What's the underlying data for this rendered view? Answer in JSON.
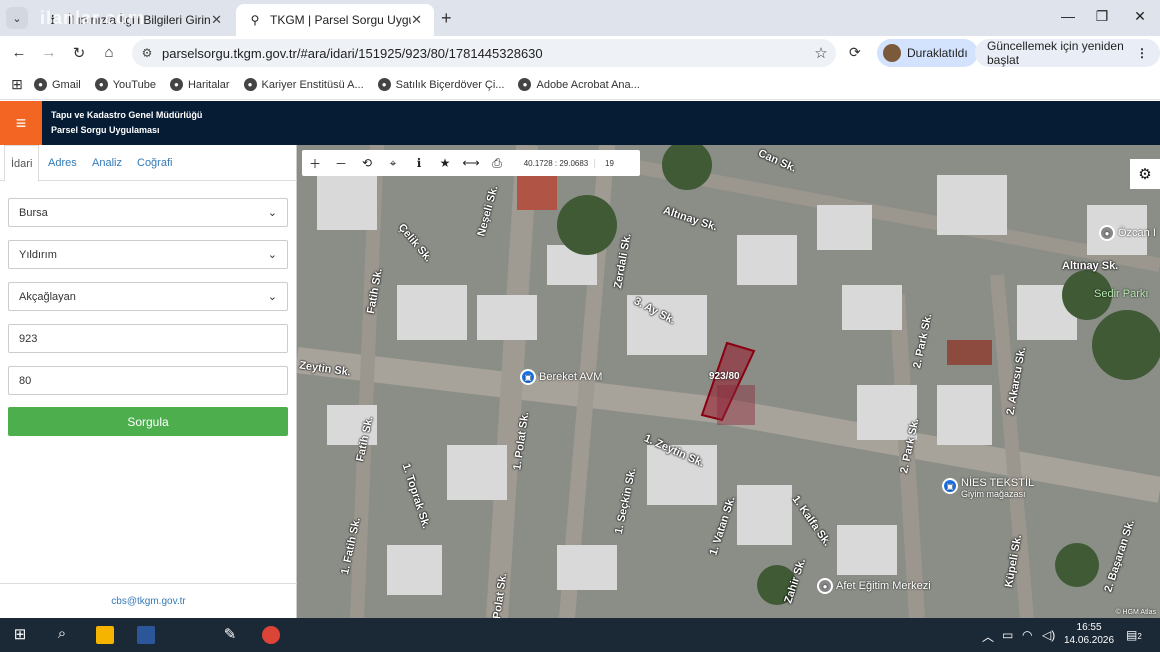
{
  "browser": {
    "tabs": [
      {
        "title": "İl ınınızla İlgili Bilgileri Girin",
        "icon": "info-icon"
      },
      {
        "title": "TKGM | Parsel Sorgu Uygulamas",
        "icon": "location-pin-icon"
      }
    ],
    "watermark": "ilanlar.com",
    "url": "parselsorgu.tkgm.gov.tr/#ara/idari/151925/923/80/1781445328630",
    "profile_label": "Duraklatıldı",
    "update_label": "Güncellemek için yeniden başlat",
    "bookmarks": [
      "Gmail",
      "YouTube",
      "Haritalar",
      "Kariyer Enstitüsü A...",
      "Satılık Biçerdöver Çi...",
      "Adobe Acrobat Ana..."
    ]
  },
  "app": {
    "org_name": "Tapu ve Kadastro Genel Müdürlüğü",
    "app_name": "Parsel Sorgu Uygulaması",
    "tabs": [
      "İdari",
      "Adres",
      "Analiz",
      "Coğrafi"
    ],
    "fields": {
      "il": "Bursa",
      "ilce": "Yıldırım",
      "mahalle": "Akçağlayan",
      "ada": "923",
      "parsel": "80"
    },
    "submit_label": "Sorgula",
    "contact_email": "cbs@tkgm.gov.tr"
  },
  "map": {
    "coords": "40.1728 : 29.0683",
    "zoom": "19",
    "parcel_label": "923/80",
    "attribution": "© HGM Atlas",
    "streets": [
      "Can Sk.",
      "Altınay Sk.",
      "Neşeli Sk.",
      "Çelik Sk.",
      "Zerdali Sk.",
      "3. Ay Sk.",
      "Fatih Sk.",
      "Zeytin Sk.",
      "1. Zeytin Sk.",
      "1. Polat Sk.",
      "1. Seçkin Sk.",
      "1. Vatan Sk.",
      "1. Kalfa Sk.",
      "Fatih Sk.",
      "1. Toprak Sk.",
      "1. Fatih Sk.",
      "Polat Sk.",
      "Zahir Sk.",
      "2. Park Sk.",
      "2. Akarsu Sk.",
      "2. Park Sk.",
      "Altınay Sk.",
      "Küpeli Sk.",
      "2. Başaran Sk."
    ],
    "pois": [
      {
        "name": "Bereket AVM",
        "sub": ""
      },
      {
        "name": "NİES TEKSTİL",
        "sub": "Giyim mağazası"
      },
      {
        "name": "Afet Eğitim Merkezi",
        "sub": ""
      },
      {
        "name": "Özcan I",
        "sub": ""
      },
      {
        "name": "Sedir Parkı",
        "sub": ""
      }
    ]
  },
  "taskbar": {
    "time": "16:55",
    "date": "14.06.2026",
    "notifications": "2"
  }
}
